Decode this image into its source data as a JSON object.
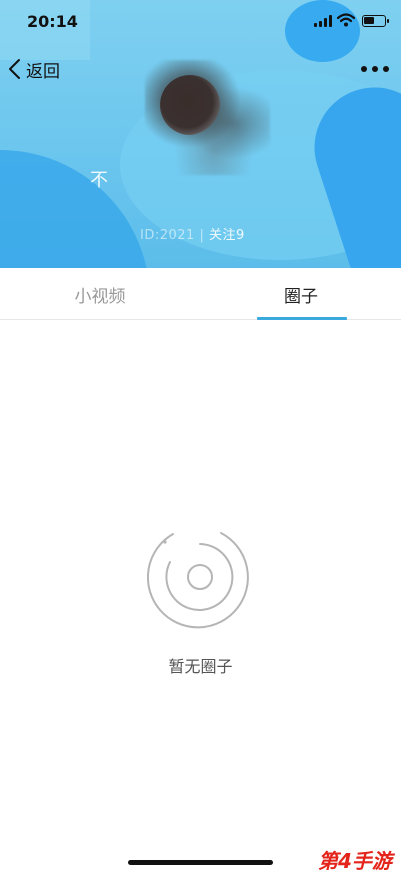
{
  "status_bar": {
    "time": "20:14"
  },
  "header": {
    "back_label": "返回",
    "more_icon": "more-icon",
    "nickname": "不",
    "meta_prefix": "ID:2021 | ",
    "follow_text": "关注9"
  },
  "tabs": [
    {
      "label": "小视频",
      "active": false
    },
    {
      "label": "圈子",
      "active": true
    }
  ],
  "empty_state": {
    "icon": "empty-circle-icon",
    "message": "暂无圈子"
  },
  "watermark": "第4手游",
  "colors": {
    "cover_blue": "#6cc6ee",
    "tab_indicator": "#39a9de",
    "watermark_red": "#e4241a"
  }
}
